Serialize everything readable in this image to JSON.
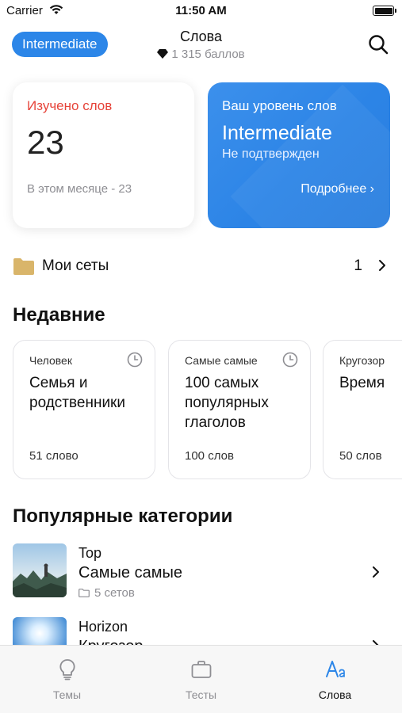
{
  "status_bar": {
    "carrier": "Carrier",
    "time": "11:50 AM"
  },
  "header": {
    "level_pill": "Intermediate",
    "title": "Слова",
    "points": "1 315 баллов"
  },
  "learned_card": {
    "title": "Изучено слов",
    "count": "23",
    "month": "В этом месяце - 23"
  },
  "level_card": {
    "caption": "Ваш уровень слов",
    "level": "Intermediate",
    "status": "Не подтвержден",
    "more": "Подробнее ›"
  },
  "my_sets": {
    "label": "Мои сеты",
    "count": "1"
  },
  "recent": {
    "title": "Недавние",
    "items": [
      {
        "category": "Человек",
        "title": "Семья и родственники",
        "count": "51 слово"
      },
      {
        "category": "Самые самые",
        "title": "100 самых популярных глаголов",
        "count": "100 слов"
      },
      {
        "category": "Кругозор",
        "title": "Время",
        "count": "50 слов"
      }
    ]
  },
  "popular": {
    "title": "Популярные категории",
    "items": [
      {
        "tag": "Top",
        "name": "Самые самые",
        "meta": "5 сетов"
      },
      {
        "tag": "Horizon",
        "name": "Кругозор"
      }
    ]
  },
  "tabs": [
    {
      "label": "Темы",
      "icon": "lightbulb-icon"
    },
    {
      "label": "Тесты",
      "icon": "briefcase-icon"
    },
    {
      "label": "Слова",
      "icon": "text-size-icon",
      "active": true
    }
  ],
  "colors": {
    "accent": "#2c86e8",
    "red": "#e6443a",
    "folder": "#d9b56a",
    "gray": "#8e8e93"
  }
}
